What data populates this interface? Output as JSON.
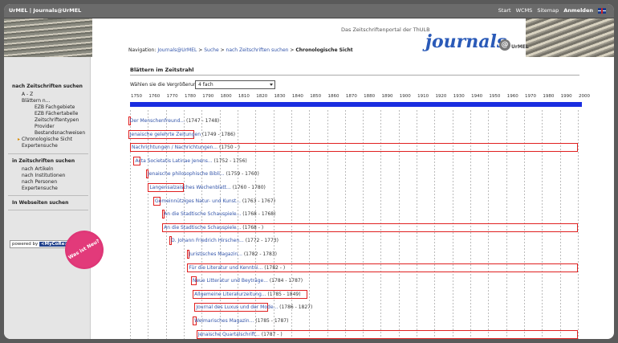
{
  "topbar": {
    "title": "UrMEL | Journals@UrMEL",
    "nav": [
      "Start",
      "WCMS",
      "Sitemap",
      "Anmelden"
    ],
    "active_nav": "Anmelden"
  },
  "header": {
    "subtitle": "Das Zeitschriftenportal der ThULB",
    "logo": "journals",
    "logo_at": "@",
    "logo_brand": "UrMEL"
  },
  "breadcrumb": {
    "prefix": "Navigation:",
    "items": [
      "Journals@UrMEL",
      "Suche",
      "nach Zeitschriften suchen"
    ],
    "separator": ">",
    "current": "Chronologische Sicht"
  },
  "sidebar": {
    "sections": [
      {
        "label": "nach Zeitschriften suchen",
        "items": [
          {
            "label": "A - Z",
            "level": 1
          },
          {
            "label": "Blättern n...",
            "level": 1
          },
          {
            "label": "EZB Fachgebiete",
            "level": 2
          },
          {
            "label": "EZB Fächertabelle",
            "level": 2
          },
          {
            "label": "Zeitschriftentypen",
            "level": 2
          },
          {
            "label": "Provider",
            "level": 2
          },
          {
            "label": "Bestandsnachweisen",
            "level": 2
          },
          {
            "label": "Chronologische Sicht",
            "level": 1,
            "active": true
          },
          {
            "label": "Expertensuche",
            "level": 1
          }
        ]
      },
      {
        "label": "in Zeitschriften suchen",
        "items": [
          {
            "label": "nach Artikeln",
            "level": 1
          },
          {
            "label": "nach Institutionen",
            "level": 1
          },
          {
            "label": "nach Personen",
            "level": 1
          },
          {
            "label": "Expertensuche",
            "level": 1
          }
        ]
      },
      {
        "label": "In Webseiten suchen",
        "items": []
      }
    ],
    "powered_by": "powered by",
    "powered_brand": "<MyCoRe>",
    "badge": "Was ist Neu?"
  },
  "content": {
    "title": "Blättern im Zeitstrahl",
    "zoom_label": "Wählen sie die Vergrößerungsfaktor",
    "zoom_value": "4 fach"
  },
  "timeline": {
    "start_year": 1750,
    "end_year": 2000,
    "step": 10,
    "axis_color": "#1a2de0",
    "marker_color": "#e02020",
    "journals": [
      {
        "name": "Der Menschenfreund...",
        "range": "(1747 - 1748)",
        "start": 1747,
        "end": 1748
      },
      {
        "name": "Jenaische gelehrte Zeitungen",
        "range": "(1749 - 1786)",
        "start": 1749,
        "end": 1786
      },
      {
        "name": "Nachrichtungen / Nachrichtungen...",
        "range": "(1750 - )",
        "start": 1750,
        "end": 2000
      },
      {
        "name": "Acta Societatis Latinae Jenens...",
        "range": "(1752 - 1756)",
        "start": 1752,
        "end": 1756
      },
      {
        "name": "Jenaische philosophische Bibli...",
        "range": "(1759 - 1760)",
        "start": 1759,
        "end": 1760
      },
      {
        "name": "Langensalzaisches Wochenblatt...",
        "range": "(1760 - 1780)",
        "start": 1760,
        "end": 1780
      },
      {
        "name": "Gemeinnütziges Natur- und Kunst...",
        "range": "(1763 - 1767)",
        "start": 1763,
        "end": 1767
      },
      {
        "name": "An die Stadtische Schauspiele...",
        "range": "(1768 - 1768)",
        "start": 1768,
        "end": 1768
      },
      {
        "name": "An die Stadtische Schauspiele...",
        "range": "(1768 - )",
        "start": 1768,
        "end": 2000
      },
      {
        "name": "D. Johann Friedrich Hirschen...",
        "range": "(1772 - 1773)",
        "start": 1772,
        "end": 1773
      },
      {
        "name": "Juristisches Magazin...",
        "range": "(1782 - 1783)",
        "start": 1782,
        "end": 1783
      },
      {
        "name": "Für die Literatur und Kenntni...",
        "range": "(1782 - )",
        "start": 1782,
        "end": 2000
      },
      {
        "name": "Neue Litteratur und Beyträge...",
        "range": "(1784 - 1787)",
        "start": 1784,
        "end": 1787
      },
      {
        "name": "Allgemeine Literaturzeitung...",
        "range": "(1785 - 1849)",
        "start": 1785,
        "end": 1849
      },
      {
        "name": "Journal des Luxus und der Mode...",
        "range": "(1786 - 1827)",
        "start": 1786,
        "end": 1827
      },
      {
        "name": "Weimarisches Magazin...",
        "range": "(1785 - 1787)",
        "start": 1785,
        "end": 1787
      },
      {
        "name": "Jenaische Quartalschrift...",
        "range": "(1787 - )",
        "start": 1787,
        "end": 2000
      }
    ]
  }
}
